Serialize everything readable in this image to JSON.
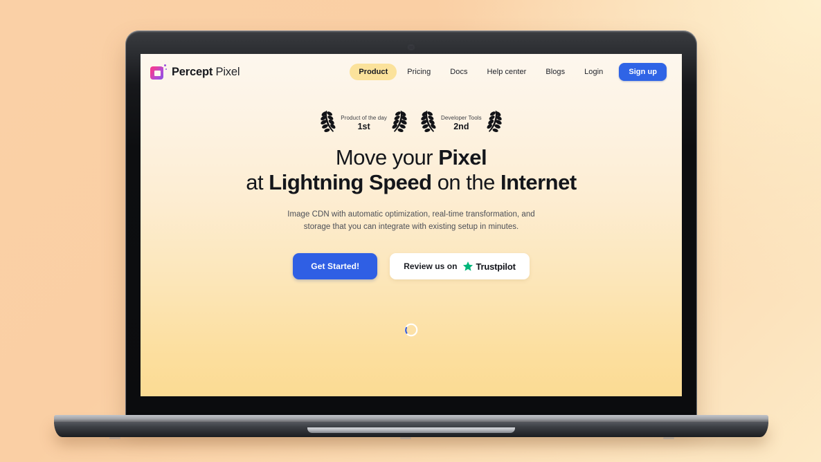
{
  "theme": {
    "page_bg_top": "#FDF7EE",
    "page_bg_bottom": "#FBDB93",
    "desktop_bg": "#FACFA4",
    "accent_blue": "#2F5FE4",
    "accent_yellow": "#FBE29B",
    "trustpilot_green": "#00B67A",
    "logo_pink": "#F0359B",
    "logo_purple": "#8A52E0"
  },
  "device": {
    "name": "laptop-mockup",
    "webcam": "webcam-dot"
  },
  "nav": {
    "brand": {
      "bold": "Percept",
      "light": " Pixel",
      "icon": "percept-pixel-logo-icon"
    },
    "links": [
      {
        "label": "Product",
        "active": true
      },
      {
        "label": "Pricing",
        "active": false
      },
      {
        "label": "Docs",
        "active": false
      },
      {
        "label": "Help center",
        "active": false
      },
      {
        "label": "Blogs",
        "active": false
      },
      {
        "label": "Login",
        "active": false
      }
    ],
    "cta": "Sign up"
  },
  "badges": [
    {
      "icon_left": "laurel-left-icon",
      "line1": "Product of the day",
      "line2": "1st",
      "icon_right": "laurel-right-icon"
    },
    {
      "icon_left": "laurel-left-icon",
      "line1": "Developer Tools",
      "line2": "2nd",
      "icon_right": "laurel-right-icon"
    }
  ],
  "hero": {
    "headline": {
      "line1_part1": "Move your ",
      "line1_bold": "Pixel",
      "line2_part1": "at ",
      "line2_bold1": "Lightning Speed",
      "line2_part2": " on the ",
      "line2_bold2": "Internet"
    },
    "subtitle_line1": "Image CDN with automatic optimization, real-time transformation, and",
    "subtitle_line2": "storage that you can integrate with existing setup in minutes.",
    "primary_cta": "Get Started!",
    "trust_label": "Review us on",
    "trust_brand": "Trustpilot",
    "trust_star_icon": "trustpilot-star-icon"
  },
  "loader": {
    "icon": "loading-spinner-icon",
    "label": ""
  }
}
